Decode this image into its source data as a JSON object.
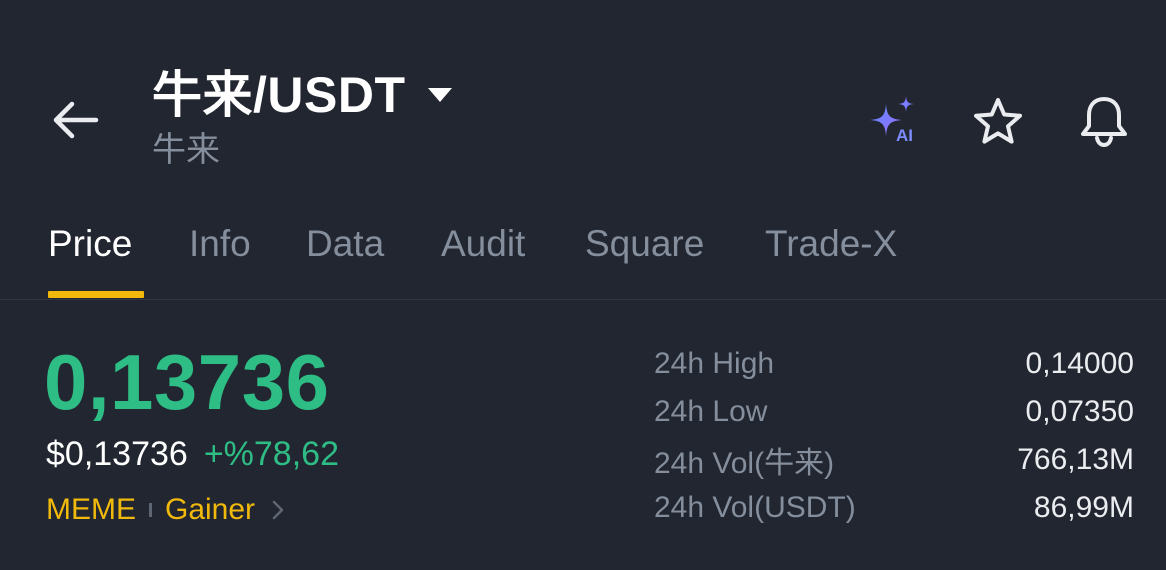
{
  "header": {
    "pair_title": "牛来/USDT",
    "pair_subtitle": "牛来",
    "icons": {
      "back": "arrow-left-icon",
      "caret": "caret-down-icon",
      "ai": "ai-sparkle-icon",
      "favorite": "star-icon",
      "alert": "bell-icon"
    },
    "ai_label": "AI"
  },
  "tabs": [
    {
      "label": "Price",
      "active": true
    },
    {
      "label": "Info",
      "active": false
    },
    {
      "label": "Data",
      "active": false
    },
    {
      "label": "Audit",
      "active": false
    },
    {
      "label": "Square",
      "active": false
    },
    {
      "label": "Trade-X",
      "active": false
    }
  ],
  "price": {
    "last": "0,13736",
    "usd": "$0,13736",
    "change": "+%78,62"
  },
  "tags": [
    "MEME",
    "Gainer"
  ],
  "stats": [
    {
      "label": "24h High",
      "value": "0,14000"
    },
    {
      "label": "24h Low",
      "value": "0,07350"
    },
    {
      "label": "24h Vol(牛来)",
      "value": "766,13M"
    },
    {
      "label": "24h Vol(USDT)",
      "value": "86,99M"
    }
  ],
  "colors": {
    "background": "#222630",
    "accent": "#f0b90b",
    "positive": "#2ebd85",
    "muted": "#848e9c"
  }
}
